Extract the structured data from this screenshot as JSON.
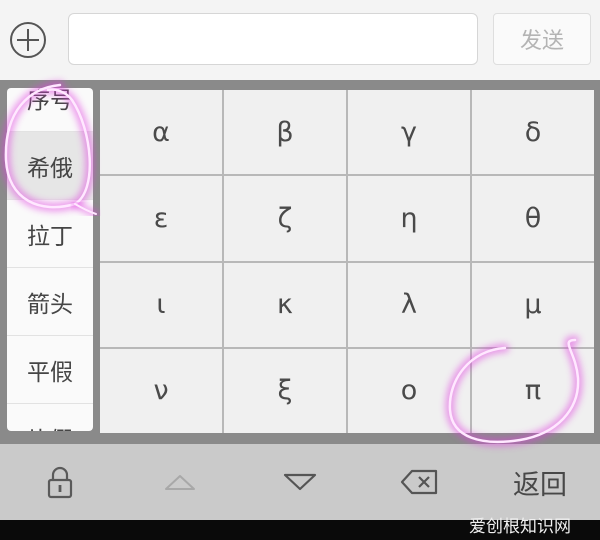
{
  "topbar": {
    "add_icon": "plus-circle-icon",
    "input_value": "",
    "send_label": "发送"
  },
  "categories": [
    {
      "label": "序号",
      "selected": false
    },
    {
      "label": "希俄",
      "selected": true
    },
    {
      "label": "拉丁",
      "selected": false
    },
    {
      "label": "箭头",
      "selected": false
    },
    {
      "label": "平假",
      "selected": false
    },
    {
      "label": "片假",
      "selected": false
    }
  ],
  "symbols": [
    "α",
    "β",
    "γ",
    "δ",
    "ε",
    "ζ",
    "η",
    "θ",
    "ι",
    "κ",
    "λ",
    "μ",
    "ν",
    "ξ",
    "ο",
    "π"
  ],
  "toolbar": {
    "lock_icon": "lock-icon",
    "up_icon": "triangle-up-icon",
    "down_icon": "triangle-down-icon",
    "delete_icon": "backspace-icon",
    "back_label": "返回"
  },
  "watermark": "爱创根知识网",
  "colors": {
    "highlight": "#e040e0",
    "keyboard_bg": "#8a8a8a",
    "toolbar_bg": "#cacaca"
  }
}
